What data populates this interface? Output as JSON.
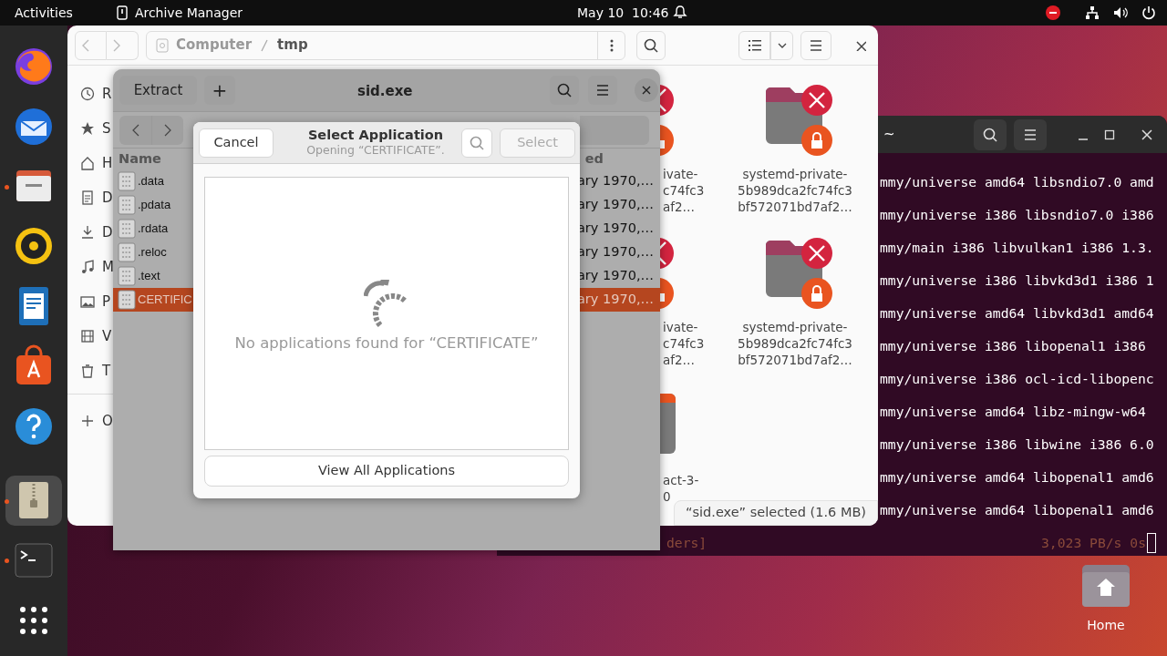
{
  "top_bar": {
    "activities": "Activities",
    "app_name": "Archive Manager",
    "clock": "May 10  10:46"
  },
  "dock": [
    {
      "kind": "browser",
      "running": false,
      "selected": false
    },
    {
      "kind": "mail",
      "running": false,
      "selected": false
    },
    {
      "kind": "files",
      "running": true,
      "selected": false
    },
    {
      "kind": "music",
      "running": false,
      "selected": false
    },
    {
      "kind": "writer",
      "running": false,
      "selected": false
    },
    {
      "kind": "store",
      "running": false,
      "selected": false
    },
    {
      "kind": "help",
      "running": false,
      "selected": false
    },
    {
      "kind": "archive",
      "running": true,
      "selected": true
    },
    {
      "kind": "terminal",
      "running": true,
      "selected": false
    },
    {
      "kind": "grid",
      "running": false,
      "selected": false
    }
  ],
  "terminal": {
    "title": "~",
    "lines": [
      "mmy/universe amd64 libsndio7.0 amd",
      "mmy/universe i386 libsndio7.0 i386",
      "mmy/main i386 libvulkan1 i386 1.3.",
      "mmy/universe i386 libvkd3d1 i386 1",
      "mmy/universe amd64 libvkd3d1 amd64",
      "mmy/universe i386 libopenal1 i386",
      "mmy/universe i386 ocl-icd-libopenc",
      "mmy/universe amd64 libz-mingw-w64",
      "mmy/universe i386 libwine i386 6.0",
      "mmy/universe amd64 libopenal1 amd6",
      "mmy/universe amd64 libopenal1 amd6"
    ],
    "status_left": "ders]",
    "status_right": "3,023 PB/s 0s"
  },
  "desktop_icon": {
    "label": "Home"
  },
  "files_window": {
    "path": [
      "Computer",
      "tmp"
    ],
    "sidebar": [
      {
        "kind": "recent",
        "label": "R"
      },
      {
        "kind": "star",
        "label": "S"
      },
      {
        "kind": "home",
        "label": "H"
      },
      {
        "kind": "doc",
        "label": "D"
      },
      {
        "kind": "download",
        "label": "D"
      },
      {
        "kind": "music",
        "label": "M"
      },
      {
        "kind": "picture",
        "label": "P"
      },
      {
        "kind": "video",
        "label": "V"
      },
      {
        "kind": "trash",
        "label": "T"
      },
      {
        "kind": "other",
        "label": "O"
      }
    ],
    "items": [
      {
        "kind": "locked",
        "lines": [
          "ivate-",
          "c74fc3",
          "af2…"
        ]
      },
      {
        "kind": "locked",
        "lines": [
          "systemd-private-",
          "5b989dca2fc74fc3",
          "bf572071bd7af2…"
        ]
      },
      {
        "kind": "locked",
        "lines": [
          "ivate-",
          "c74fc3",
          "af2…"
        ]
      },
      {
        "kind": "locked",
        "lines": [
          "systemd-private-",
          "5b989dca2fc74fc3",
          "bf572071bd7af2…"
        ]
      },
      {
        "kind": "folder",
        "lines": [
          "act-3-",
          "0"
        ]
      }
    ],
    "status": "“sid.exe” selected (1.6 MB)"
  },
  "archive_window": {
    "title": "sid.exe",
    "extract": "Extract",
    "add": "+",
    "columns": [
      "Name",
      "ed"
    ],
    "rows": [
      {
        "name": ".data",
        "date": "ary 1970,…",
        "selected": false
      },
      {
        "name": ".pdata",
        "date": "ary 1970,…",
        "selected": false
      },
      {
        "name": ".rdata",
        "date": "ary 1970,…",
        "selected": false
      },
      {
        "name": ".reloc",
        "date": "ary 1970,…",
        "selected": false
      },
      {
        "name": ".text",
        "date": "ary 1970,…",
        "selected": false
      },
      {
        "name": "CERTIFIC",
        "date": "ary 1970,…",
        "selected": true
      }
    ]
  },
  "dialog": {
    "cancel": "Cancel",
    "title": "Select Application",
    "subtitle": "Opening “CERTIFICATE”.",
    "select": "Select",
    "select_disabled": true,
    "message": "No applications found for “CERTIFICATE”",
    "view_all": "View All Applications"
  }
}
